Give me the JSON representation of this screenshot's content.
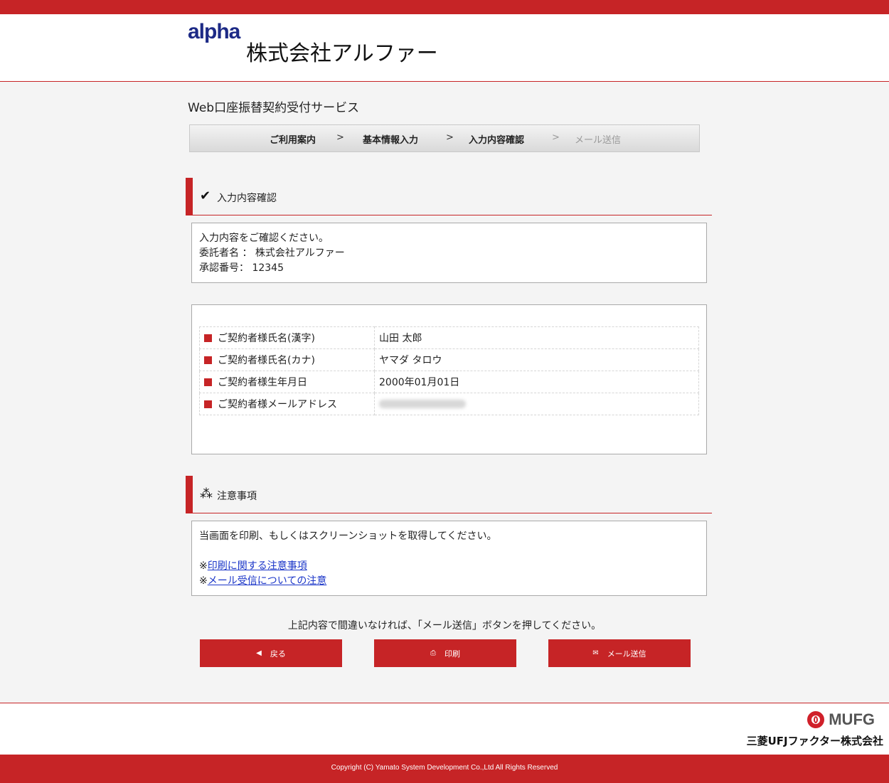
{
  "header": {
    "logo_text": "alpha",
    "company_name": "株式会社アルファー"
  },
  "service_title": "Web口座振替契約受付サービス",
  "steps": [
    {
      "label": "ご利用案内",
      "state": "done"
    },
    {
      "label": "基本情報入力",
      "state": "done"
    },
    {
      "label": "入力内容確認",
      "state": "current"
    },
    {
      "label": "メール送信",
      "state": "upcoming"
    }
  ],
  "step_separator": ">",
  "confirm_section": {
    "icon": "check-icon",
    "title": "入力内容確認",
    "lines": [
      "入力内容をご確認ください。",
      "委託者名 ： 株式会社アルファー",
      "承認番号： 12345"
    ]
  },
  "details": {
    "rows": [
      {
        "label": "ご契約者様氏名(漢字)",
        "value": "山田 太郎"
      },
      {
        "label": "ご契約者様氏名(カナ)",
        "value": "ヤマダ タロウ"
      },
      {
        "label": "ご契約者様生年月日",
        "value": "2000年01月01日"
      },
      {
        "label": "ご契約者様メールアドレス",
        "value": ""
      }
    ]
  },
  "notice_section": {
    "icon": "spinner-icon",
    "title": "注意事項",
    "text": "当画面を印刷、もしくはスクリーンショットを取得してください。",
    "link_prefix": "※",
    "links": [
      "印刷に関する注意事項",
      "メール受信についての注意"
    ]
  },
  "instruction": "上記内容で間違いなければ、「メール送信」ボタンを押してください。",
  "buttons": {
    "back": {
      "label": "戻る",
      "icon": "back-arrow-icon"
    },
    "print": {
      "label": "印刷",
      "icon": "print-icon"
    },
    "send": {
      "label": "メール送信",
      "icon": "mail-icon"
    }
  },
  "footer": {
    "mufg_text": "MUFG",
    "mufg_company": "三菱UFJファクター株式会社",
    "copyright": "Copyright (C) Yamato System Development Co.,Ltd All Rights Reserved"
  },
  "colors": {
    "brand_red": "#c62426",
    "logo_blue": "#1d2a86",
    "link_blue": "#1a35c8"
  }
}
